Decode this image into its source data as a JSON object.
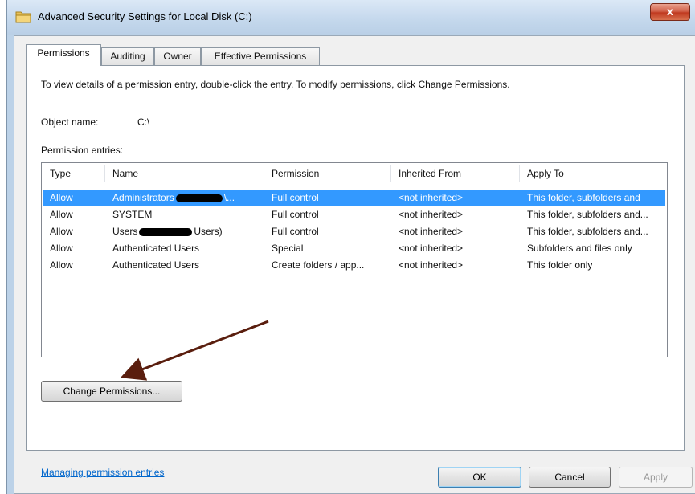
{
  "window": {
    "title": "Advanced Security Settings for Local Disk (C:)",
    "close_glyph": "x",
    "icon": "folder-icon"
  },
  "tabs": [
    {
      "label": "Permissions",
      "active": true
    },
    {
      "label": "Auditing",
      "active": false
    },
    {
      "label": "Owner",
      "active": false
    },
    {
      "label": "Effective Permissions",
      "active": false
    }
  ],
  "permissions_tab": {
    "info_text": "To view details of a permission entry, double-click the entry. To modify permissions, click Change Permissions.",
    "object_name_label": "Object name:",
    "object_name_value": "C:\\",
    "entries_label": "Permission entries:",
    "columns": [
      "Type",
      "Name",
      "Permission",
      "Inherited From",
      "Apply To"
    ],
    "rows": [
      {
        "type": "Allow",
        "name": "Administrators",
        "name_suffix": "\\",
        "permission": "Full control",
        "inherited": "<not inherited>",
        "apply_to": "This folder, subfolders and",
        "selected": true
      },
      {
        "type": "Allow",
        "name": "SYSTEM",
        "name_suffix": "",
        "permission": "Full control",
        "inherited": "<not inherited>",
        "apply_to": "This folder, subfolders and...",
        "selected": false
      },
      {
        "type": "Allow",
        "name": "Users",
        "name_suffix": "Users)",
        "permission": "Full control",
        "inherited": "<not inherited>",
        "apply_to": "This folder, subfolders and...",
        "selected": false
      },
      {
        "type": "Allow",
        "name": "Authenticated Users",
        "name_suffix": "",
        "permission": "Special",
        "inherited": "<not inherited>",
        "apply_to": "Subfolders and files only",
        "selected": false
      },
      {
        "type": "Allow",
        "name": "Authenticated Users",
        "name_suffix": "",
        "permission": "Create folders / app...",
        "inherited": "<not inherited>",
        "apply_to": "This folder only",
        "selected": false
      }
    ],
    "change_button": "Change Permissions...",
    "manage_link": "Managing permission entries"
  },
  "footer": {
    "ok": "OK",
    "cancel": "Cancel",
    "apply": "Apply"
  },
  "colors": {
    "selection": "#3399ff",
    "arrow": "#5a1e0e",
    "link": "#0066cc"
  }
}
